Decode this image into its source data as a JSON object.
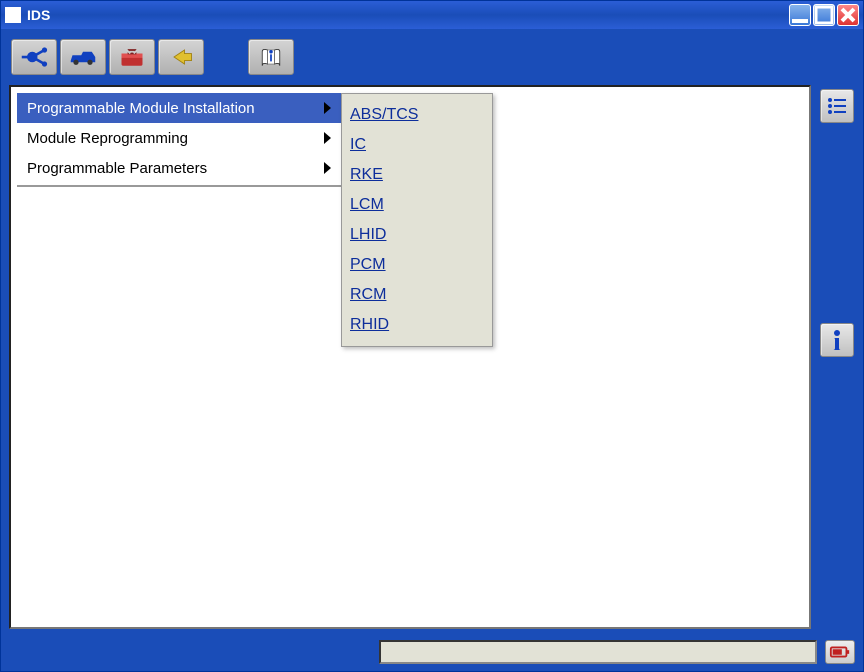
{
  "window": {
    "title": "IDS"
  },
  "menu": {
    "items": [
      {
        "label": "Programmable Module Installation",
        "selected": true
      },
      {
        "label": "Module Reprogramming",
        "selected": false
      },
      {
        "label": "Programmable Parameters",
        "selected": false
      }
    ]
  },
  "submenu": {
    "items": [
      {
        "label": "ABS/TCS"
      },
      {
        "label": "IC"
      },
      {
        "label": "RKE"
      },
      {
        "label": "LCM"
      },
      {
        "label": "LHID"
      },
      {
        "label": "PCM"
      },
      {
        "label": "RCM"
      },
      {
        "label": "RHID"
      }
    ]
  },
  "toolbar": {
    "icons": [
      "connector-icon",
      "vehicle-icon",
      "toolbox-icon",
      "arrow-left-icon",
      "book-info-icon"
    ]
  },
  "sidebar": {
    "icons": [
      "list-icon",
      "info-icon"
    ]
  },
  "status": {
    "icon": "battery-icon"
  }
}
